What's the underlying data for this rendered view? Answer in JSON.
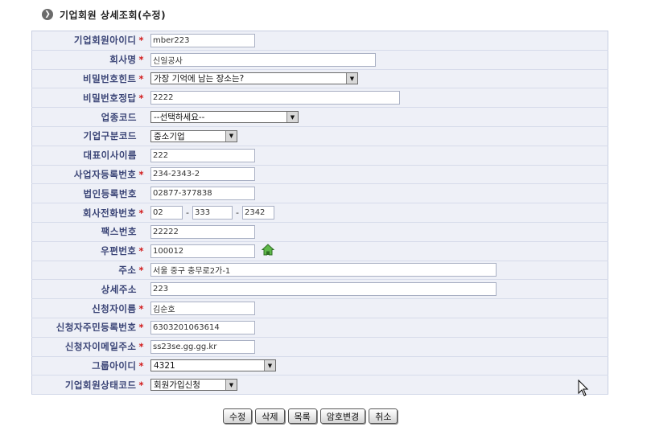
{
  "page": {
    "title": "기업회원 상세조회(수정)",
    "title_icon": "chevron-right-icon"
  },
  "fields": {
    "member_id": {
      "label": "기업회원아이디",
      "value": "mber223"
    },
    "company_name": {
      "label": "회사명",
      "value": "신일공사"
    },
    "password_hint": {
      "label": "비밀번호힌트",
      "selected": "가장 기억에 남는 장소는?"
    },
    "password_answer": {
      "label": "비밀번호정답",
      "value": "2222"
    },
    "industry_code": {
      "label": "업종코드",
      "selected": "--선택하세요--"
    },
    "company_type": {
      "label": "기업구분코드",
      "selected": "중소기업"
    },
    "ceo_name": {
      "label": "대표이사이름",
      "value": "222"
    },
    "business_reg_no": {
      "label": "사업자등록번호",
      "value": "234-2343-2"
    },
    "corp_reg_no": {
      "label": "법인등록번호",
      "value": "02877-377838"
    },
    "phone": {
      "label": "회사전화번호",
      "part1": "02",
      "part2": "333",
      "part3": "2342",
      "separator": "-"
    },
    "fax": {
      "label": "팩스번호",
      "value": "22222"
    },
    "zip": {
      "label": "우편번호",
      "value": "100012",
      "icon": "home-icon"
    },
    "address": {
      "label": "주소",
      "value": "서울 중구 충무로2가-1"
    },
    "address_detail": {
      "label": "상세주소",
      "value": "223"
    },
    "applicant_name": {
      "label": "신청자이름",
      "value": "김순호"
    },
    "applicant_rrn": {
      "label": "신청자주민등록번호",
      "value": "6303201063614"
    },
    "applicant_email": {
      "label": "신청자이메일주소",
      "value": "ss23se.gg.gg.kr"
    },
    "group_id": {
      "label": "그룹아이디",
      "selected": "4321"
    },
    "member_status": {
      "label": "기업회원상태코드",
      "selected": "회원가입신청"
    }
  },
  "required_marker": "*",
  "buttons": {
    "modify": "수정",
    "delete": "삭제",
    "list": "목록",
    "change_password": "암호변경",
    "cancel": "취소"
  },
  "colors": {
    "label_text": "#3a4476",
    "required": "#d21b1b",
    "form_bg": "#eef0f7"
  }
}
